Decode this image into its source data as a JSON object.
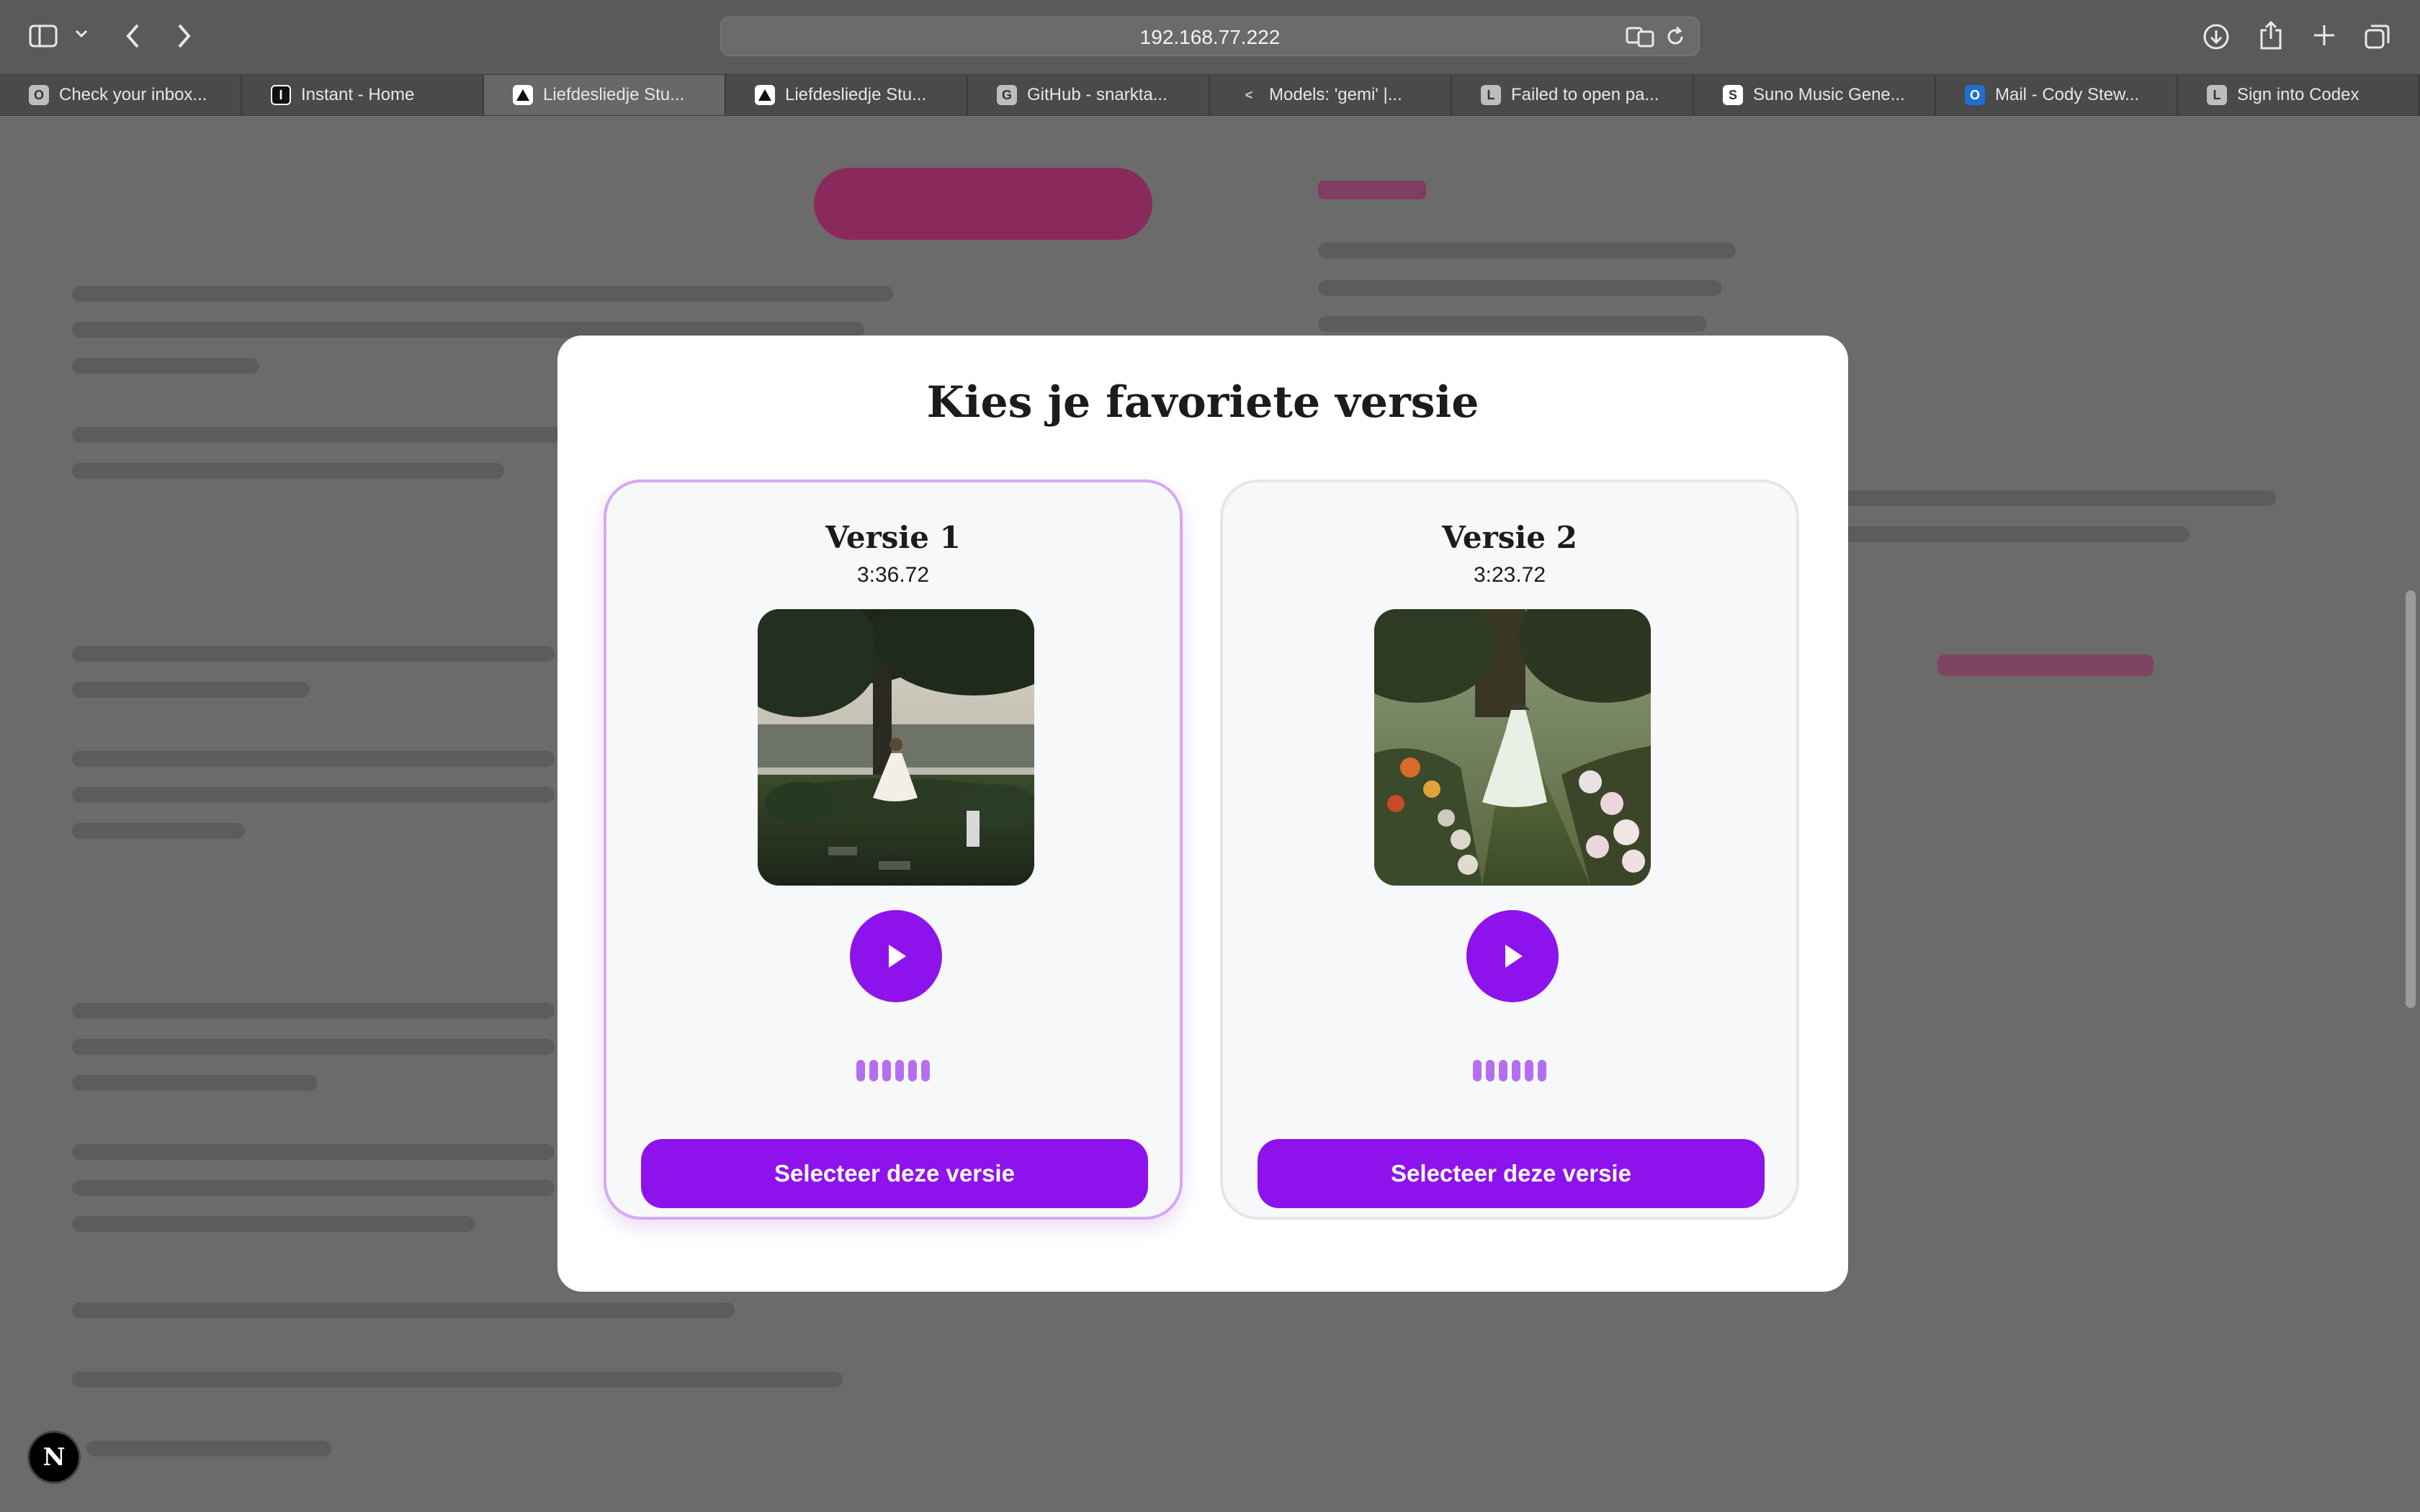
{
  "browser": {
    "url": "192.168.77.222",
    "tabs": [
      {
        "favicon": "O",
        "label": "Check your inbox...",
        "active": false
      },
      {
        "favicon": "I",
        "label": "Instant - Home",
        "active": false
      },
      {
        "favicon": "triangle",
        "label": "Liefdesliedje Stu...",
        "active": true
      },
      {
        "favicon": "triangle",
        "label": "Liefdesliedje Stu...",
        "active": false
      },
      {
        "favicon": "G",
        "label": "GitHub - snarkta...",
        "active": false
      },
      {
        "favicon": "<",
        "label": "Models: 'gemi' |...",
        "active": false
      },
      {
        "favicon": "L",
        "label": "Failed to open pa...",
        "active": false
      },
      {
        "favicon": "S",
        "label": "Suno Music Gene...",
        "active": false
      },
      {
        "favicon": "O",
        "label": "Mail - Cody Stew...",
        "active": false
      },
      {
        "favicon": "L",
        "label": "Sign into Codex",
        "active": false
      }
    ],
    "icons": [
      "sidebar-icon",
      "chevron-down-icon",
      "back-icon",
      "forward-icon",
      "translate-icon",
      "reload-icon",
      "download-icon",
      "share-icon",
      "new-tab-icon",
      "tab-overview-icon"
    ]
  },
  "modal": {
    "title": "Kies je favoriete versie",
    "versions": [
      {
        "title": "Versie 1",
        "duration": "3:36.72",
        "button_label": "Selecteer deze versie",
        "selected": true
      },
      {
        "title": "Versie 2",
        "duration": "3:23.72",
        "button_label": "Selecteer deze versie",
        "selected": false
      }
    ]
  },
  "fab": {
    "label": "N"
  },
  "colors": {
    "accent": "#8e12ec",
    "selected_border": "#d7a7f3",
    "wave": "#b36ff0"
  }
}
